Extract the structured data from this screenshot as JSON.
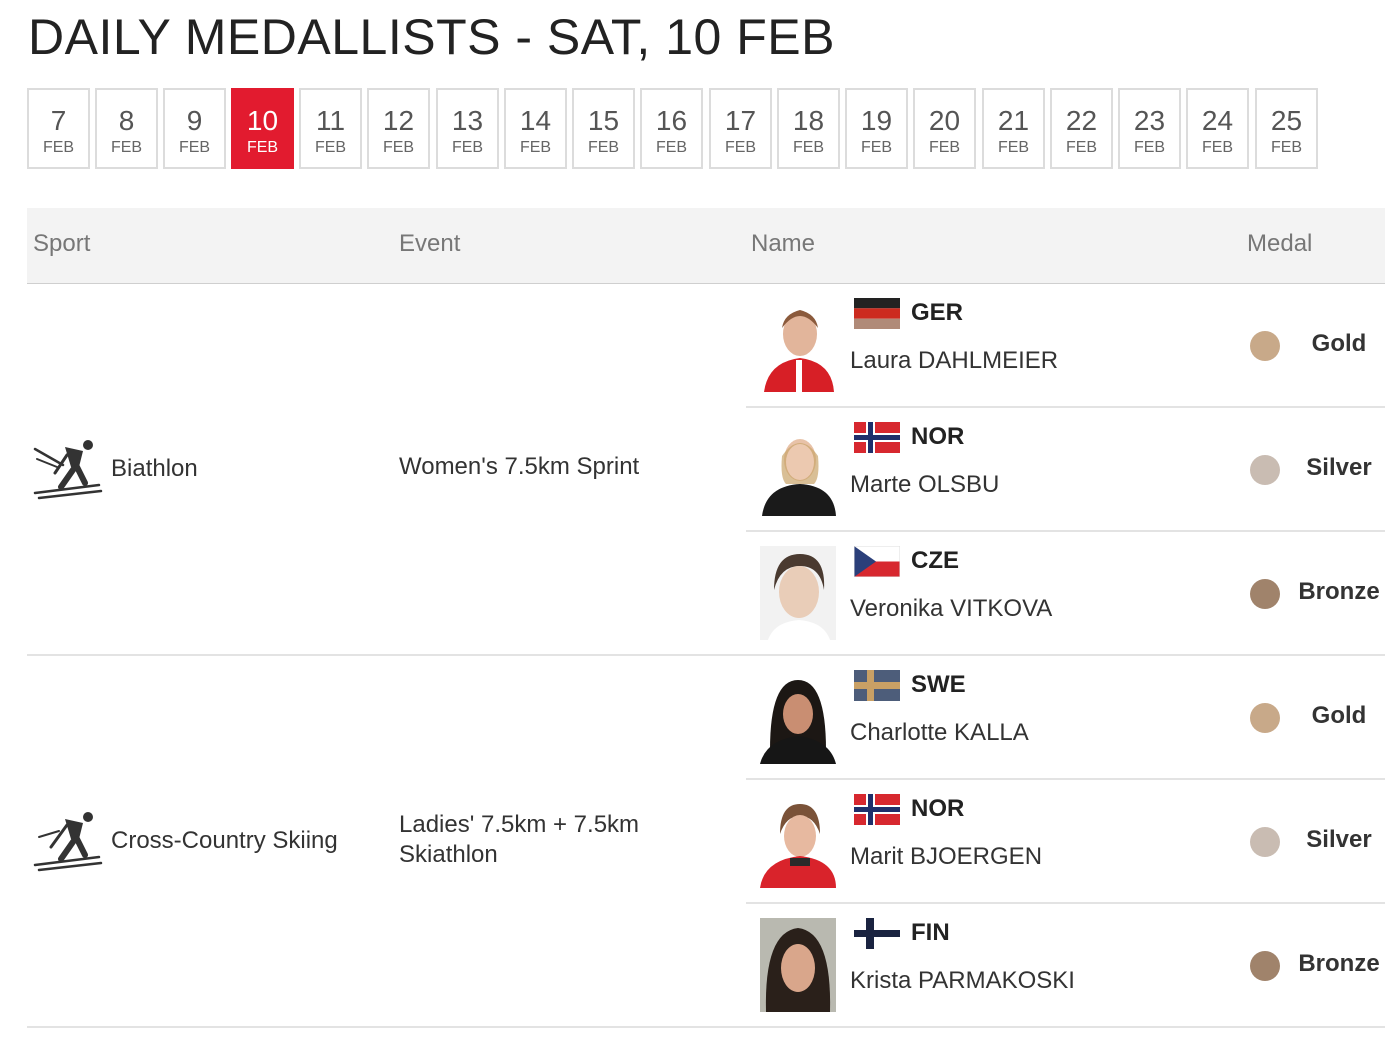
{
  "page": {
    "title": "DAILY MEDALLISTS - SAT, 10 FEB",
    "accent_color": "#e21b2f"
  },
  "dates": [
    {
      "day": "7",
      "month": "FEB",
      "active": false
    },
    {
      "day": "8",
      "month": "FEB",
      "active": false
    },
    {
      "day": "9",
      "month": "FEB",
      "active": false
    },
    {
      "day": "10",
      "month": "FEB",
      "active": true
    },
    {
      "day": "11",
      "month": "FEB",
      "active": false
    },
    {
      "day": "12",
      "month": "FEB",
      "active": false
    },
    {
      "day": "13",
      "month": "FEB",
      "active": false
    },
    {
      "day": "14",
      "month": "FEB",
      "active": false
    },
    {
      "day": "15",
      "month": "FEB",
      "active": false
    },
    {
      "day": "16",
      "month": "FEB",
      "active": false
    },
    {
      "day": "17",
      "month": "FEB",
      "active": false
    },
    {
      "day": "18",
      "month": "FEB",
      "active": false
    },
    {
      "day": "19",
      "month": "FEB",
      "active": false
    },
    {
      "day": "20",
      "month": "FEB",
      "active": false
    },
    {
      "day": "21",
      "month": "FEB",
      "active": false
    },
    {
      "day": "22",
      "month": "FEB",
      "active": false
    },
    {
      "day": "23",
      "month": "FEB",
      "active": false
    },
    {
      "day": "24",
      "month": "FEB",
      "active": false
    },
    {
      "day": "25",
      "month": "FEB",
      "active": false
    }
  ],
  "table": {
    "headers": {
      "sport": "Sport",
      "event": "Event",
      "name": "Name",
      "medal": "Medal"
    },
    "rows": [
      {
        "sport": "Biathlon",
        "sport_icon": "biathlon-icon",
        "event": "Women's 7.5km Sprint",
        "medallists": [
          {
            "country": "GER",
            "flag": "germany-flag",
            "name": "Laura DAHLMEIER",
            "medal": "Gold",
            "medal_color": "#c8a989"
          },
          {
            "country": "NOR",
            "flag": "norway-flag",
            "name": "Marte OLSBU",
            "medal": "Silver",
            "medal_color": "#c9bcb2"
          },
          {
            "country": "CZE",
            "flag": "czech-flag",
            "name": "Veronika VITKOVA",
            "medal": "Bronze",
            "medal_color": "#a0836b"
          }
        ]
      },
      {
        "sport": "Cross-Country Skiing",
        "sport_icon": "cross-country-skiing-icon",
        "event": "Ladies' 7.5km + 7.5km Skiathlon",
        "medallists": [
          {
            "country": "SWE",
            "flag": "sweden-flag",
            "name": "Charlotte KALLA",
            "medal": "Gold",
            "medal_color": "#c8a989"
          },
          {
            "country": "NOR",
            "flag": "norway-flag",
            "name": "Marit BJOERGEN",
            "medal": "Silver",
            "medal_color": "#c9bcb2"
          },
          {
            "country": "FIN",
            "flag": "finland-flag",
            "name": "Krista PARMAKOSKI",
            "medal": "Bronze",
            "medal_color": "#a0836b"
          }
        ]
      }
    ]
  }
}
